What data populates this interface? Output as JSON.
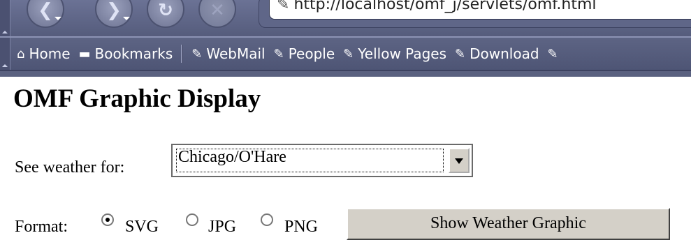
{
  "browser": {
    "nav_buttons": [
      {
        "icon": "back-arrow-icon",
        "glyph": "❮"
      },
      {
        "icon": "forward-arrow-icon",
        "glyph": "❯"
      },
      {
        "icon": "reload-icon",
        "glyph": "↻"
      },
      {
        "icon": "stop-icon",
        "glyph": "✕"
      }
    ],
    "url": "http://localhost/omf_j/servlets/omf.html",
    "personal_toolbar": [
      {
        "icon": "home-icon",
        "label": "Home"
      },
      {
        "icon": "folder-icon",
        "label": "Bookmarks"
      },
      {
        "icon": "bookmark-icon",
        "label": "WebMail"
      },
      {
        "icon": "bookmark-icon",
        "label": "People"
      },
      {
        "icon": "bookmark-icon",
        "label": "Yellow Pages"
      },
      {
        "icon": "bookmark-icon",
        "label": "Download"
      }
    ]
  },
  "page": {
    "title": "OMF Graphic Display",
    "weather_label": "See weather for:",
    "location_select": {
      "selected": "Chicago/O'Hare"
    },
    "format_label": "Format:",
    "formats": [
      {
        "label": "SVG",
        "checked": true
      },
      {
        "label": "JPG",
        "checked": false
      },
      {
        "label": "PNG",
        "checked": false
      }
    ],
    "submit_label": "Show Weather Graphic"
  }
}
